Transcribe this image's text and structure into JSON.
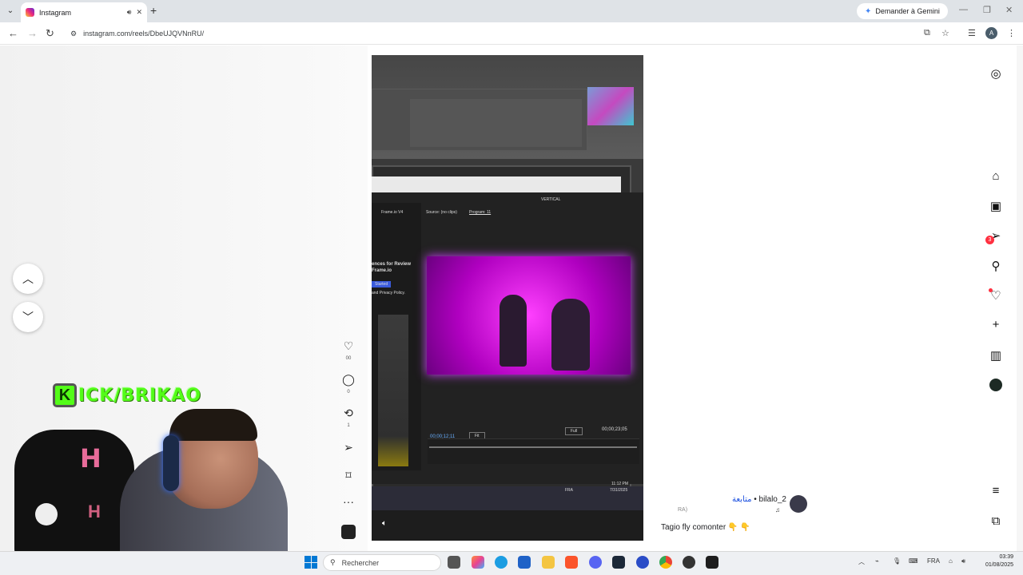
{
  "browser": {
    "tab_title": "Instagram",
    "new_tab_symbol": "+",
    "gemini_label": "Demander à Gemini",
    "url": "instagram.com/reels/DbeUJQVNnRU/"
  },
  "reel": {
    "video_text": {
      "left_header": "Frame.io V4",
      "source_tab": "Source: (no clips)",
      "program_tab": "Program: 11",
      "promo_title": "ences for Review",
      "promo_sub": "Frame.io",
      "started": "Started",
      "privacy": "and Privacy Policy.",
      "timecode_left": "00;00;12;11",
      "fit": "Fit",
      "full": "Full",
      "timecode_right": "00;00;23;05",
      "vertical": "VERTICAL",
      "lang": "FRA",
      "time": "11:12 PM",
      "date": "7/31/2025"
    },
    "like_count": "00",
    "comment_count": "0",
    "repost_count": "1",
    "username": "bilalo_2",
    "follow_label": "متابعة",
    "separator": "•",
    "music_note": "♫",
    "ra_text": "RA)",
    "caption": "Tagio fly comonter 👇 👇"
  },
  "overlay": {
    "kick_letter": "K",
    "kick_text": "ICK/BRIKAO",
    "chair_logo": "H"
  },
  "taskbar": {
    "search_placeholder": "Rechercher",
    "language": "FRA",
    "time": "03:39",
    "date": "01/08/2025"
  },
  "notifications_badge": "3",
  "colors": {
    "kick_green": "#53fc18",
    "instagram_red": "#ff3040",
    "follow_blue": "#1a4fe0"
  },
  "icons": [
    "instagram-icon",
    "home-icon",
    "reels-icon",
    "messages-icon",
    "search-icon",
    "notifications-icon",
    "create-icon",
    "dashboard-icon",
    "more-icon",
    "also-from-meta-icon"
  ]
}
